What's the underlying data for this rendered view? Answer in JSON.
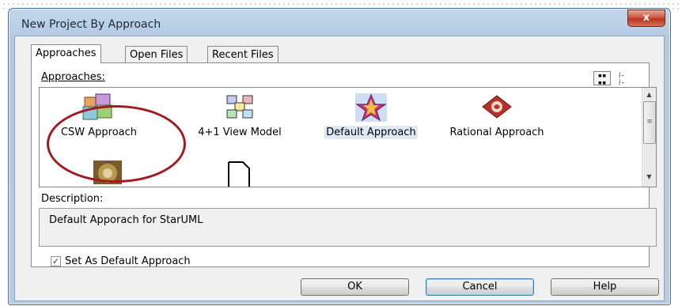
{
  "window": {
    "title": "New Project By Approach",
    "close_label": "x"
  },
  "tabs": [
    {
      "label": "Approaches",
      "active": true
    },
    {
      "label": "Open Files",
      "active": false
    },
    {
      "label": "Recent Files",
      "active": false
    }
  ],
  "approaches": {
    "label": "Approaches:",
    "view_large_icons": "large-icons-view-icon",
    "view_list": "list-view-icon",
    "items": [
      {
        "label": "CSW Approach",
        "icon": "csw-approach-icon"
      },
      {
        "label": "4+1 View Model",
        "icon": "view-model-icon"
      },
      {
        "label": "Default Approach",
        "icon": "default-approach-icon",
        "selected": true
      },
      {
        "label": "Rational Approach",
        "icon": "rational-approach-icon"
      },
      {
        "label": "",
        "icon": "image-approach-icon"
      },
      {
        "label": "",
        "icon": "empty-document-icon"
      }
    ],
    "circled_item": "CSW Approach"
  },
  "description": {
    "label": "Description:",
    "text": "Default Apporach for StarUML"
  },
  "default_checkbox": {
    "label": "Set As Default Approach",
    "checked": true
  },
  "buttons": {
    "ok": "OK",
    "cancel": "Cancel",
    "help": "Help"
  },
  "colors": {
    "annotation_circle": "#a01b22",
    "window_frame": "#b7cbe3",
    "selection": "#dfe8f5"
  }
}
